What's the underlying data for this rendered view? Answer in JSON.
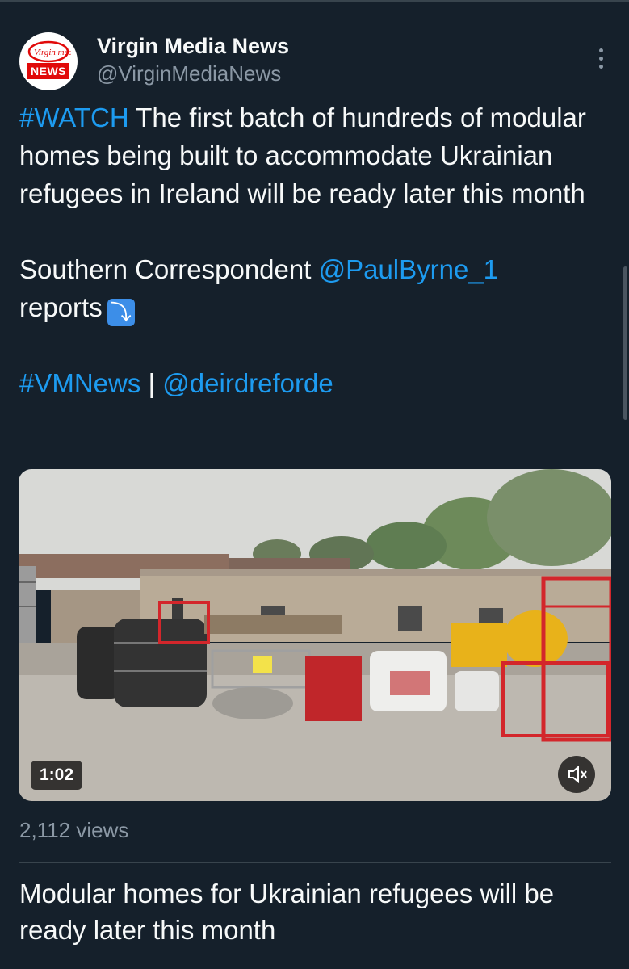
{
  "account": {
    "display_name": "Virgin Media News",
    "handle": "@VirginMediaNews",
    "avatar_label": "NEWS",
    "avatar_brand": "Virgin media"
  },
  "tweet": {
    "hashtag_watch": "#WATCH",
    "line1_rest": " The first batch of hundreds of modular homes being built to accommodate Ukrainian refugees in Ireland will be ready later this month",
    "correspondent_prefix": "Southern Correspondent ",
    "correspondent_mention": "@PaulByrne_1",
    "reports_text": "reports",
    "arrow_emoji": "⤵",
    "hashtag_vmnews": "#VMNews",
    "separator": " | ",
    "mention_deirdre": "@deirdreforde"
  },
  "video": {
    "duration": "1:02",
    "mute_icon": "speaker-muted-icon"
  },
  "views_text": "2,112 views",
  "card_title": "Modular homes for Ukrainian refugees will be ready later this month",
  "colors": {
    "background": "#15202b",
    "link": "#1d9bf0",
    "secondary_text": "#8b98a5",
    "brand_red": "#e10a0a"
  }
}
